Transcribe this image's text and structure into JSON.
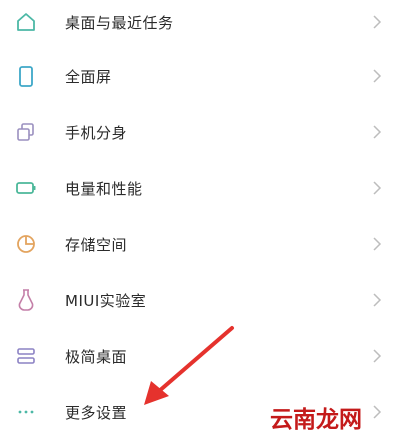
{
  "settings_list": {
    "items": [
      {
        "label": "桌面与最近任务",
        "icon": "home-icon",
        "icon_color": "#4cb8a6"
      },
      {
        "label": "全面屏",
        "icon": "phone-icon",
        "icon_color": "#3ea8c8"
      },
      {
        "label": "手机分身",
        "icon": "clone-icon",
        "icon_color": "#9a8fbf"
      },
      {
        "label": "电量和性能",
        "icon": "battery-icon",
        "icon_color": "#4cb89a"
      },
      {
        "label": "存储空间",
        "icon": "storage-pie-icon",
        "icon_color": "#e3a45f"
      },
      {
        "label": "MIUI实验室",
        "icon": "flask-icon",
        "icon_color": "#c47fa8"
      },
      {
        "label": "极简桌面",
        "icon": "minimal-desktop-icon",
        "icon_color": "#8c82c4"
      },
      {
        "label": "更多设置",
        "icon": "more-dots-icon",
        "icon_color": "#4cb8a6"
      }
    ]
  },
  "annotation": {
    "arrow_color": "#e5322d"
  },
  "watermark": {
    "text": "云南龙网",
    "color": "#c41a1a"
  },
  "chevron_color": "#bdbdbd"
}
